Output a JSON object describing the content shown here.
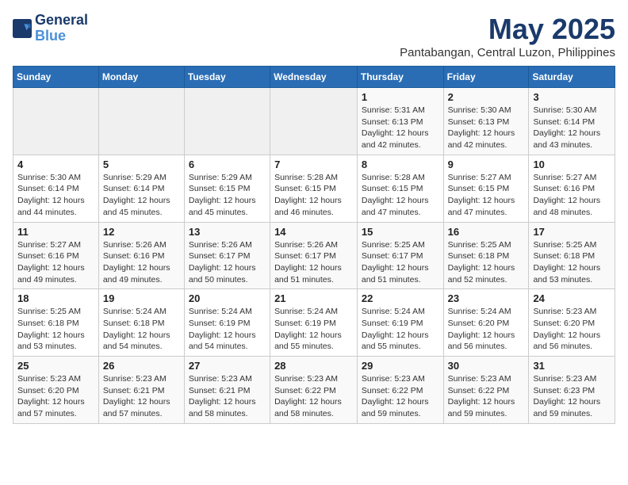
{
  "logo": {
    "line1": "General",
    "line2": "Blue"
  },
  "title": "May 2025",
  "location": "Pantabangan, Central Luzon, Philippines",
  "weekdays": [
    "Sunday",
    "Monday",
    "Tuesday",
    "Wednesday",
    "Thursday",
    "Friday",
    "Saturday"
  ],
  "weeks": [
    [
      {
        "day": "",
        "info": ""
      },
      {
        "day": "",
        "info": ""
      },
      {
        "day": "",
        "info": ""
      },
      {
        "day": "",
        "info": ""
      },
      {
        "day": "1",
        "info": "Sunrise: 5:31 AM\nSunset: 6:13 PM\nDaylight: 12 hours\nand 42 minutes."
      },
      {
        "day": "2",
        "info": "Sunrise: 5:30 AM\nSunset: 6:13 PM\nDaylight: 12 hours\nand 42 minutes."
      },
      {
        "day": "3",
        "info": "Sunrise: 5:30 AM\nSunset: 6:14 PM\nDaylight: 12 hours\nand 43 minutes."
      }
    ],
    [
      {
        "day": "4",
        "info": "Sunrise: 5:30 AM\nSunset: 6:14 PM\nDaylight: 12 hours\nand 44 minutes."
      },
      {
        "day": "5",
        "info": "Sunrise: 5:29 AM\nSunset: 6:14 PM\nDaylight: 12 hours\nand 45 minutes."
      },
      {
        "day": "6",
        "info": "Sunrise: 5:29 AM\nSunset: 6:15 PM\nDaylight: 12 hours\nand 45 minutes."
      },
      {
        "day": "7",
        "info": "Sunrise: 5:28 AM\nSunset: 6:15 PM\nDaylight: 12 hours\nand 46 minutes."
      },
      {
        "day": "8",
        "info": "Sunrise: 5:28 AM\nSunset: 6:15 PM\nDaylight: 12 hours\nand 47 minutes."
      },
      {
        "day": "9",
        "info": "Sunrise: 5:27 AM\nSunset: 6:15 PM\nDaylight: 12 hours\nand 47 minutes."
      },
      {
        "day": "10",
        "info": "Sunrise: 5:27 AM\nSunset: 6:16 PM\nDaylight: 12 hours\nand 48 minutes."
      }
    ],
    [
      {
        "day": "11",
        "info": "Sunrise: 5:27 AM\nSunset: 6:16 PM\nDaylight: 12 hours\nand 49 minutes."
      },
      {
        "day": "12",
        "info": "Sunrise: 5:26 AM\nSunset: 6:16 PM\nDaylight: 12 hours\nand 49 minutes."
      },
      {
        "day": "13",
        "info": "Sunrise: 5:26 AM\nSunset: 6:17 PM\nDaylight: 12 hours\nand 50 minutes."
      },
      {
        "day": "14",
        "info": "Sunrise: 5:26 AM\nSunset: 6:17 PM\nDaylight: 12 hours\nand 51 minutes."
      },
      {
        "day": "15",
        "info": "Sunrise: 5:25 AM\nSunset: 6:17 PM\nDaylight: 12 hours\nand 51 minutes."
      },
      {
        "day": "16",
        "info": "Sunrise: 5:25 AM\nSunset: 6:18 PM\nDaylight: 12 hours\nand 52 minutes."
      },
      {
        "day": "17",
        "info": "Sunrise: 5:25 AM\nSunset: 6:18 PM\nDaylight: 12 hours\nand 53 minutes."
      }
    ],
    [
      {
        "day": "18",
        "info": "Sunrise: 5:25 AM\nSunset: 6:18 PM\nDaylight: 12 hours\nand 53 minutes."
      },
      {
        "day": "19",
        "info": "Sunrise: 5:24 AM\nSunset: 6:18 PM\nDaylight: 12 hours\nand 54 minutes."
      },
      {
        "day": "20",
        "info": "Sunrise: 5:24 AM\nSunset: 6:19 PM\nDaylight: 12 hours\nand 54 minutes."
      },
      {
        "day": "21",
        "info": "Sunrise: 5:24 AM\nSunset: 6:19 PM\nDaylight: 12 hours\nand 55 minutes."
      },
      {
        "day": "22",
        "info": "Sunrise: 5:24 AM\nSunset: 6:19 PM\nDaylight: 12 hours\nand 55 minutes."
      },
      {
        "day": "23",
        "info": "Sunrise: 5:24 AM\nSunset: 6:20 PM\nDaylight: 12 hours\nand 56 minutes."
      },
      {
        "day": "24",
        "info": "Sunrise: 5:23 AM\nSunset: 6:20 PM\nDaylight: 12 hours\nand 56 minutes."
      }
    ],
    [
      {
        "day": "25",
        "info": "Sunrise: 5:23 AM\nSunset: 6:20 PM\nDaylight: 12 hours\nand 57 minutes."
      },
      {
        "day": "26",
        "info": "Sunrise: 5:23 AM\nSunset: 6:21 PM\nDaylight: 12 hours\nand 57 minutes."
      },
      {
        "day": "27",
        "info": "Sunrise: 5:23 AM\nSunset: 6:21 PM\nDaylight: 12 hours\nand 58 minutes."
      },
      {
        "day": "28",
        "info": "Sunrise: 5:23 AM\nSunset: 6:22 PM\nDaylight: 12 hours\nand 58 minutes."
      },
      {
        "day": "29",
        "info": "Sunrise: 5:23 AM\nSunset: 6:22 PM\nDaylight: 12 hours\nand 59 minutes."
      },
      {
        "day": "30",
        "info": "Sunrise: 5:23 AM\nSunset: 6:22 PM\nDaylight: 12 hours\nand 59 minutes."
      },
      {
        "day": "31",
        "info": "Sunrise: 5:23 AM\nSunset: 6:23 PM\nDaylight: 12 hours\nand 59 minutes."
      }
    ]
  ]
}
